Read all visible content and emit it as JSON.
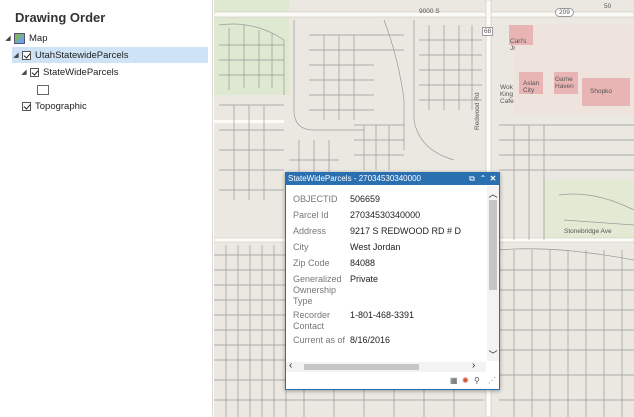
{
  "toc": {
    "title": "Drawing Order",
    "items": [
      {
        "label": "Map"
      },
      {
        "label": "UtahStatewideParcels"
      },
      {
        "label": "StateWideParcels"
      },
      {
        "label": "Topographic"
      }
    ]
  },
  "map_labels": {
    "street_9000s": "9000 S",
    "route_209": "209",
    "route_68": "68",
    "street_redwood": "Redwood Rd",
    "street_stonebridge": "Stonebridge Ave",
    "poi_carls": "Carl's Jr",
    "poi_asian_city": "Asian City",
    "poi_game_haven": "Game Haven",
    "poi_wok_king": "Wok King Cafe",
    "poi_shopko": "Shopko",
    "route_50": "50"
  },
  "popup": {
    "title": "StateWideParcels - 27034530340000",
    "rows": [
      {
        "key": "OBJECTID",
        "value": "506659"
      },
      {
        "key": "Parcel Id",
        "value": "27034530340000"
      },
      {
        "key": "Address",
        "value": "9217 S REDWOOD RD # D"
      },
      {
        "key": "City",
        "value": "West Jordan"
      },
      {
        "key": "Zip Code",
        "value": "84088"
      },
      {
        "key": "Generalized Ownership Type",
        "value": "Private"
      },
      {
        "key": "Recorder Contact",
        "value": "1-801-468-3391"
      },
      {
        "key": "Current as of",
        "value": "8/16/2016"
      }
    ]
  },
  "colors": {
    "popup_header": "#2a6fb0",
    "selection": "#cfe3f7",
    "map_background": "#eae8e1",
    "parcel_line": "#9a9a9a",
    "shopping_area": "#e8b4b4"
  },
  "icons": {
    "popup_pop_out": "pop-out-icon",
    "popup_collapse": "collapse-icon",
    "popup_close": "close-icon",
    "scroll_up": "chevron-up-icon",
    "scroll_down": "chevron-down-icon",
    "scroll_left": "chevron-left-icon",
    "scroll_right": "chevron-right-icon"
  }
}
